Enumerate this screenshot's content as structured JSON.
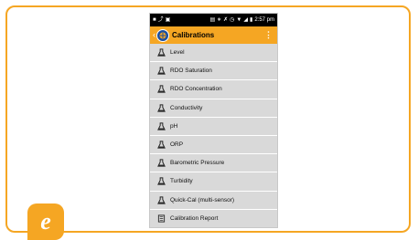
{
  "status_bar": {
    "time": "2:57 pm",
    "icons": [
      "notification-icon",
      "usb-icon",
      "image-icon",
      "nfc-icon",
      "bluetooth-icon",
      "mute-icon",
      "alarm-icon",
      "wifi-icon",
      "signal-icon",
      "battery-icon"
    ]
  },
  "app_bar": {
    "title": "Calibrations",
    "accent_color": "#f5a623",
    "logo_color": "#1c4fa0"
  },
  "menu": {
    "items": [
      {
        "label": "Level",
        "icon": "flask-icon"
      },
      {
        "label": "RDO Saturation",
        "icon": "flask-icon"
      },
      {
        "label": "RDO Concentration",
        "icon": "flask-icon"
      },
      {
        "label": "Conductivity",
        "icon": "flask-icon"
      },
      {
        "label": "pH",
        "icon": "flask-icon"
      },
      {
        "label": "ORP",
        "icon": "flask-icon"
      },
      {
        "label": "Barometric Pressure",
        "icon": "flask-icon"
      },
      {
        "label": "Turbidity",
        "icon": "flask-icon"
      },
      {
        "label": "Quick-Cal (multi-sensor)",
        "icon": "flask-icon"
      },
      {
        "label": "Calibration Report",
        "icon": "report-icon"
      }
    ]
  },
  "badge": {
    "letter": "e",
    "color": "#f5a623"
  },
  "frame": {
    "border_color": "#f5a623"
  }
}
